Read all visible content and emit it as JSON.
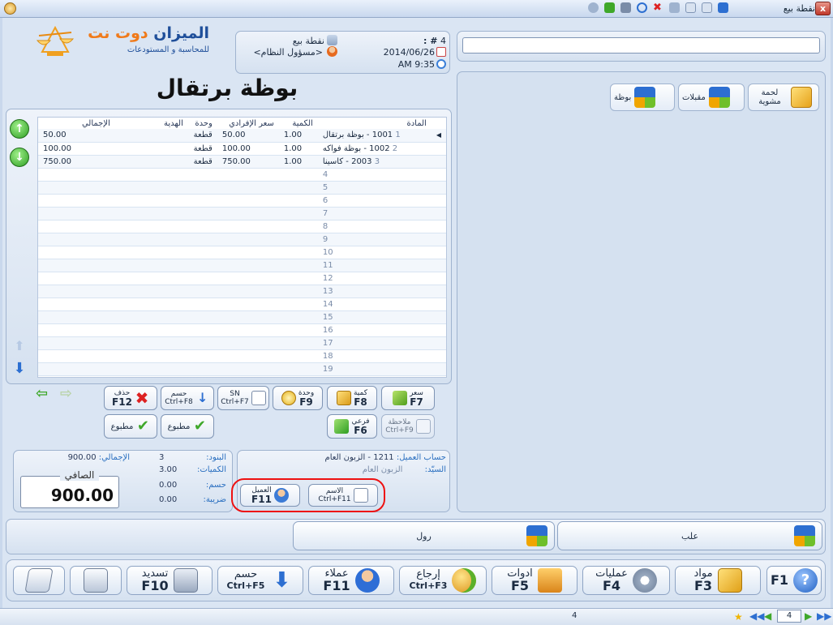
{
  "window": {
    "title": "نقطة بيع",
    "close_label": "x"
  },
  "logo": {
    "name_main": "الميزان",
    "name_accent": "دوت نت",
    "subtitle": "للمحاسبة و المستودعات"
  },
  "session": {
    "screen": "نقطة بيع",
    "user": "<مسؤول النظام>",
    "number_label": "# :",
    "number": "4",
    "date": "2014/06/26",
    "time": "AM 9:35"
  },
  "current_item": "بوظة برتقال",
  "categories": [
    {
      "label": "لحمة مشوية",
      "icon": "box-icon"
    },
    {
      "label": "مقبلات",
      "icon": "cubes-icon"
    },
    {
      "label": "بوظة",
      "icon": "cubes-icon"
    }
  ],
  "grid": {
    "columns": [
      "المادة",
      "الكمية",
      "سعر الإفرادي",
      "وحدة",
      "الهدية",
      "الإجمالي"
    ],
    "rows": [
      {
        "n": "1",
        "item": "1001 - بوظة برتقال",
        "qty": "1.00",
        "price": "50.00",
        "unit": "قطعة",
        "gift": "",
        "total": "50.00"
      },
      {
        "n": "2",
        "item": "1002 - بوظة فواكه",
        "qty": "1.00",
        "price": "100.00",
        "unit": "قطعة",
        "gift": "",
        "total": "100.00"
      },
      {
        "n": "3",
        "item": "2003 - كاسينا",
        "qty": "1.00",
        "price": "750.00",
        "unit": "قطعة",
        "gift": "",
        "total": "750.00"
      },
      {
        "n": "4"
      },
      {
        "n": "5"
      },
      {
        "n": "6"
      },
      {
        "n": "7"
      },
      {
        "n": "8"
      },
      {
        "n": "9"
      },
      {
        "n": "10"
      },
      {
        "n": "11"
      },
      {
        "n": "12"
      },
      {
        "n": "13"
      },
      {
        "n": "14"
      },
      {
        "n": "15"
      },
      {
        "n": "16"
      },
      {
        "n": "17"
      },
      {
        "n": "18"
      },
      {
        "n": "19"
      }
    ]
  },
  "actions": {
    "price": {
      "label": "سعر",
      "key": "F7"
    },
    "qty": {
      "label": "كمية",
      "key": "F8"
    },
    "unit": {
      "label": "وحدة",
      "key": "F9"
    },
    "sn": {
      "label": "SN",
      "key": "Ctrl+F7"
    },
    "discount": {
      "label": "حسم",
      "key": "Ctrl+F8"
    },
    "delete": {
      "label": "حذف",
      "key": "F12"
    },
    "note": {
      "label": "ملاحظة",
      "key": "Ctrl+F9"
    },
    "sub": {
      "label": "فرعي",
      "key": "F6"
    },
    "printed1": {
      "label": "مطبوع"
    },
    "printed2": {
      "label": "مطبوع"
    }
  },
  "customer": {
    "account_label": "حساب العميل:",
    "account_value": "1211 - الزبون العام",
    "mr_label": "السيّد:",
    "mr_value": "الزبون العام",
    "name_btn": {
      "label": "الاسم",
      "key": "Ctrl+F11"
    },
    "client_btn": {
      "label": "العميل",
      "key": "F11"
    }
  },
  "summary": {
    "items_label": "البنود:",
    "items_value": "3",
    "qtys_label": "الكميات:",
    "qtys_value": "3.00",
    "disc_label": "حسم:",
    "disc_value": "0.00",
    "tax_label": "ضريبة:",
    "tax_value": "0.00",
    "total_label": "الإجمالي:",
    "total_value": "900.00",
    "net_label": "الصافي",
    "net_value": "900.00"
  },
  "big_items": [
    {
      "label": "علب"
    },
    {
      "label": "رول"
    }
  ],
  "toolbar": [
    {
      "label": "",
      "key": "F1",
      "icon": "help-icon"
    },
    {
      "label": "مواد",
      "key": "F3",
      "icon": "box-icon"
    },
    {
      "label": "عمليات",
      "key": "F4",
      "icon": "gears-icon"
    },
    {
      "label": "ادوات",
      "key": "F5",
      "icon": "tools-icon"
    },
    {
      "label": "إرجاع",
      "key": "Ctrl+F3",
      "icon": "return-icon"
    },
    {
      "label": "عملاء",
      "key": "F11",
      "icon": "user-icon"
    },
    {
      "label": "حسم",
      "key": "Ctrl+F5",
      "icon": "discount-icon"
    },
    {
      "label": "تسديد",
      "key": "F10",
      "icon": "calculator-icon"
    }
  ],
  "statusbar": {
    "page": "4",
    "dropdown": "4"
  }
}
